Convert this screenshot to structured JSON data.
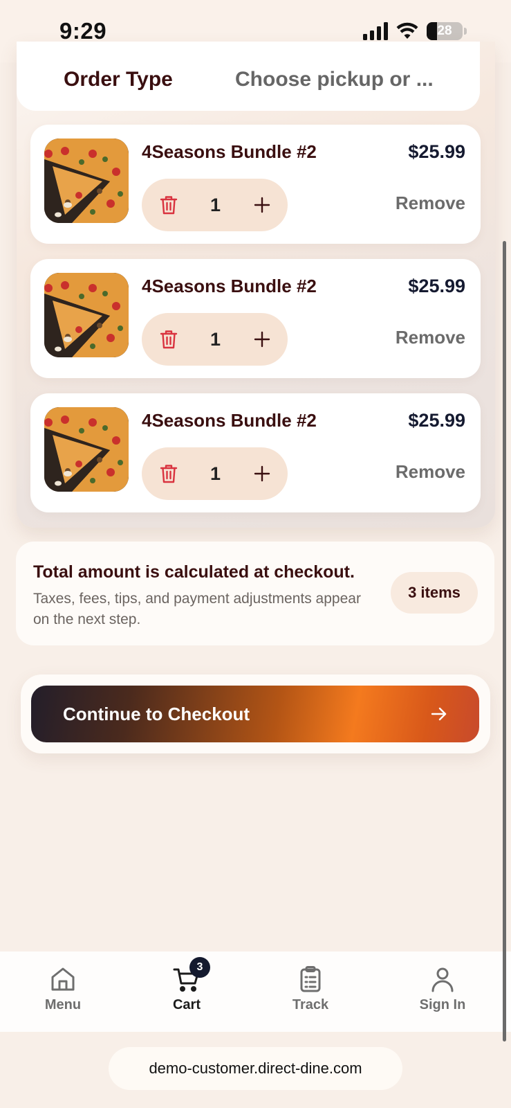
{
  "status_bar": {
    "time": "9:29",
    "battery": "28"
  },
  "order_type": {
    "label": "Order Type",
    "value": "Choose pickup or ..."
  },
  "cart_items": [
    {
      "name": "4Seasons Bundle #2",
      "price": "$25.99",
      "quantity": "1",
      "remove_label": "Remove"
    },
    {
      "name": "4Seasons Bundle #2",
      "price": "$25.99",
      "quantity": "1",
      "remove_label": "Remove"
    },
    {
      "name": "4Seasons Bundle #2",
      "price": "$25.99",
      "quantity": "1",
      "remove_label": "Remove"
    }
  ],
  "summary": {
    "title": "Total amount is calculated at checkout.",
    "note": "Taxes, fees, tips, and payment adjustments appear on the next step.",
    "items_count": "3 items"
  },
  "checkout": {
    "label": "Continue to Checkout"
  },
  "tab_bar": {
    "tabs": [
      {
        "label": "Menu",
        "icon": "home-icon"
      },
      {
        "label": "Cart",
        "icon": "cart-icon",
        "badge": "3"
      },
      {
        "label": "Track",
        "icon": "clipboard-icon"
      },
      {
        "label": "Sign In",
        "icon": "user-icon"
      }
    ]
  },
  "url": "demo-customer.direct-dine.com",
  "colors": {
    "accent_orange": "#f47a1e",
    "dark_text": "#3a0f10",
    "stepper_bg": "#f6e3d4",
    "trash_red": "#d9333f"
  }
}
